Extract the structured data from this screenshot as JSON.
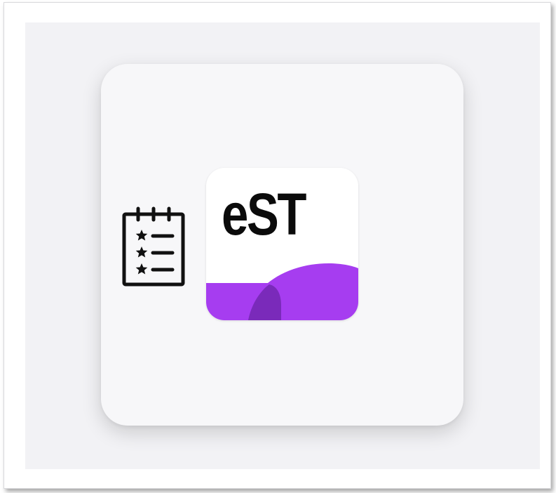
{
  "app_icon": {
    "text": "eST",
    "text_color": "#0b0b0b",
    "accent_color": "#a63df0",
    "accent_dark_color": "#7a2aba",
    "background_color": "#ffffff"
  },
  "survey_icon": {
    "name": "survey-checklist-icon",
    "stroke_color": "#111111",
    "star_rows": 3
  },
  "colors": {
    "panel_background": "#f2f2f5",
    "card_background": "#f7f7f9"
  }
}
